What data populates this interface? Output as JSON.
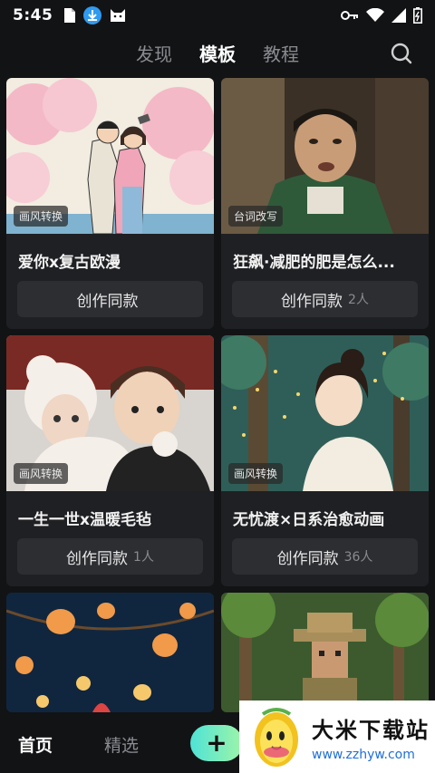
{
  "status": {
    "time": "5:45"
  },
  "tabs": [
    {
      "label": "发现",
      "active": false
    },
    {
      "label": "模板",
      "active": true
    },
    {
      "label": "教程",
      "active": false
    }
  ],
  "cards": [
    {
      "tag": "画风转换",
      "title": "爱你x复古欧漫",
      "button": "创作同款",
      "count": ""
    },
    {
      "tag": "台词改写",
      "title": "狂飙·减肥的肥是怎么...",
      "button": "创作同款",
      "count": "2人"
    },
    {
      "tag": "画风转换",
      "title": "一生一世x温暖毛毡",
      "button": "创作同款",
      "count": "1人"
    },
    {
      "tag": "画风转换",
      "title": "无忧渡×日系治愈动画",
      "button": "创作同款",
      "count": "36人"
    }
  ],
  "bottom_nav": {
    "home": "首页",
    "picks": "精选",
    "plus": "+"
  },
  "watermark": {
    "title": "大米下载站",
    "url": "www.zzhyw.com"
  },
  "colors": {
    "accent_start": "#4fe3d6",
    "accent_end": "#9ef4a8",
    "background": "#121315",
    "card": "#1f2023"
  }
}
